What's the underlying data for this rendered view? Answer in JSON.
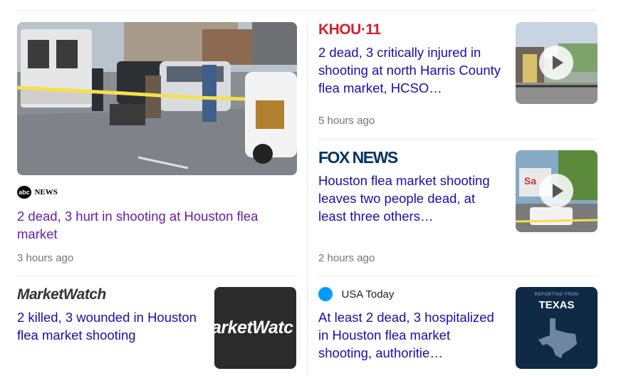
{
  "articles": [
    {
      "source": "NEWS",
      "source_logo_text": "abc",
      "title": "2 dead, 3 hurt in shooting at Houston flea market",
      "time": "3 hours ago",
      "visited": true
    },
    {
      "source": "KHOU·11",
      "title": "2 dead, 3 critically injured in shooting at north Harris County flea market, HCSO…",
      "time": "5 hours ago",
      "has_video": true
    },
    {
      "source": "FOX NEWS",
      "title": "Houston flea market shooting leaves two people dead, at least three others…",
      "time": "2 hours ago",
      "has_video": true
    },
    {
      "source": "MarketWatch",
      "thumb_text": "arketWatc",
      "title": "2 killed, 3 wounded in Houston flea market shooting"
    },
    {
      "source": "USA Today",
      "thumb_caption": "REPORTING FROM",
      "thumb_text": "TEXAS",
      "title": "At least 2 dead, 3 hospitalized in Houston flea market shooting, authoritie…"
    }
  ],
  "colors": {
    "link": "#1a0dab",
    "visited": "#681da8",
    "khou_red": "#d5202a",
    "fox_blue": "#003366",
    "marketwatch_green": "#4caf50",
    "usatoday_blue": "#009bff"
  }
}
